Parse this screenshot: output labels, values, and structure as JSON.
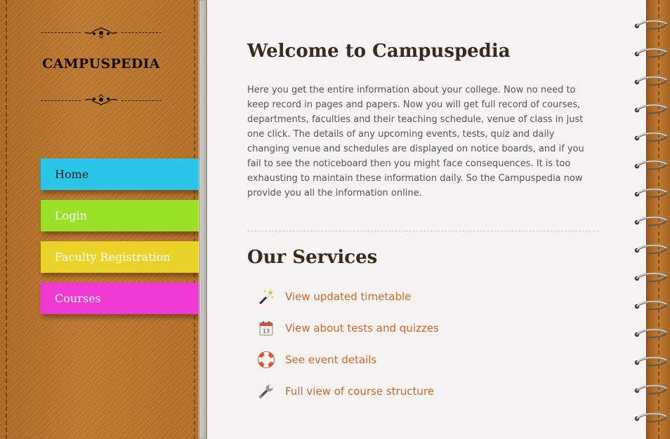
{
  "brand": {
    "name": "CAMPUSPEDIA"
  },
  "nav": {
    "items": [
      {
        "label": "Home",
        "color": "#29c6e8"
      },
      {
        "label": "Login",
        "color": "#9ae028"
      },
      {
        "label": "Faculty Registration",
        "color": "#e9d328"
      },
      {
        "label": "Courses",
        "color": "#ee3ad3"
      }
    ]
  },
  "main": {
    "title": "Welcome to Campuspedia",
    "intro": "Here you get the entire information about your college. Now no need to keep record in pages and papers. Now you will get full record of courses, departments, faculties and their teaching schedule, venue of class in just one click. The details of any upcoming events, tests, quiz and daily changing venue and schedules are displayed on notice boards, and if you fail to see the noticeboard then you might face consequences. It is too exhausting to maintain these information daily. So the Campuspedia now provide you all the information online.",
    "services_title": "Our Services",
    "services": [
      {
        "label": "View updated timetable",
        "icon": "magic-wand-icon"
      },
      {
        "label": "View about tests and quizzes",
        "icon": "calendar-icon"
      },
      {
        "label": "See event details",
        "icon": "lifebuoy-icon"
      },
      {
        "label": "Full view of course structure",
        "icon": "wrench-icon"
      }
    ],
    "calendar_day": "13"
  },
  "colors": {
    "link": "#d2691e",
    "leather": "#c07a31",
    "heading": "#3a2a1e"
  }
}
